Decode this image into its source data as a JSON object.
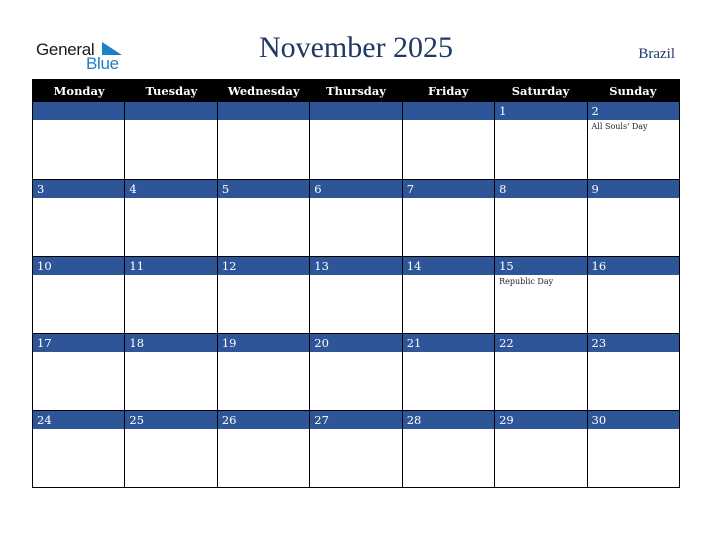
{
  "logo": {
    "general": "General",
    "blue": "Blue"
  },
  "header": {
    "title": "November 2025",
    "country": "Brazil"
  },
  "weekdays": [
    "Monday",
    "Tuesday",
    "Wednesday",
    "Thursday",
    "Friday",
    "Saturday",
    "Sunday"
  ],
  "weeks": [
    [
      {
        "d": "",
        "h": ""
      },
      {
        "d": "",
        "h": ""
      },
      {
        "d": "",
        "h": ""
      },
      {
        "d": "",
        "h": ""
      },
      {
        "d": "",
        "h": ""
      },
      {
        "d": "1",
        "h": ""
      },
      {
        "d": "2",
        "h": "All Souls' Day"
      }
    ],
    [
      {
        "d": "3",
        "h": ""
      },
      {
        "d": "4",
        "h": ""
      },
      {
        "d": "5",
        "h": ""
      },
      {
        "d": "6",
        "h": ""
      },
      {
        "d": "7",
        "h": ""
      },
      {
        "d": "8",
        "h": ""
      },
      {
        "d": "9",
        "h": ""
      }
    ],
    [
      {
        "d": "10",
        "h": ""
      },
      {
        "d": "11",
        "h": ""
      },
      {
        "d": "12",
        "h": ""
      },
      {
        "d": "13",
        "h": ""
      },
      {
        "d": "14",
        "h": ""
      },
      {
        "d": "15",
        "h": "Republic Day"
      },
      {
        "d": "16",
        "h": ""
      }
    ],
    [
      {
        "d": "17",
        "h": ""
      },
      {
        "d": "18",
        "h": ""
      },
      {
        "d": "19",
        "h": ""
      },
      {
        "d": "20",
        "h": ""
      },
      {
        "d": "21",
        "h": ""
      },
      {
        "d": "22",
        "h": ""
      },
      {
        "d": "23",
        "h": ""
      }
    ],
    [
      {
        "d": "24",
        "h": ""
      },
      {
        "d": "25",
        "h": ""
      },
      {
        "d": "26",
        "h": ""
      },
      {
        "d": "27",
        "h": ""
      },
      {
        "d": "28",
        "h": ""
      },
      {
        "d": "29",
        "h": ""
      },
      {
        "d": "30",
        "h": ""
      }
    ]
  ]
}
